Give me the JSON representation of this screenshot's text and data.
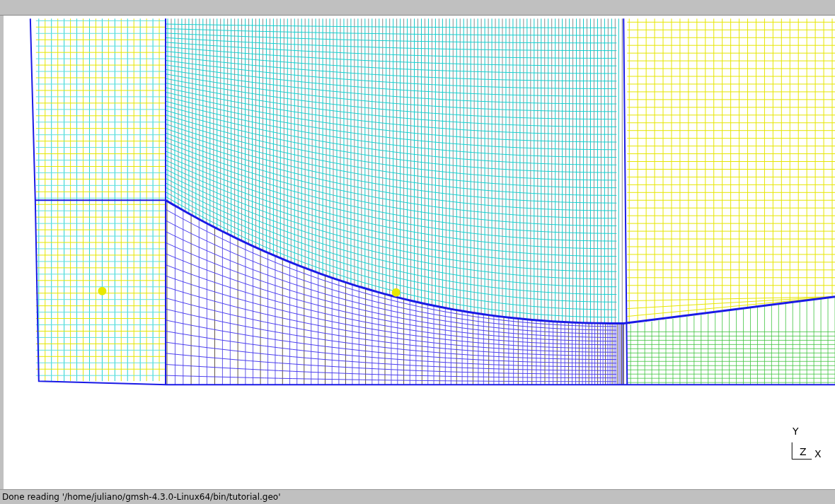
{
  "axes": [
    "Y",
    "Z",
    "X"
  ],
  "status_bar": "Done reading '/home/juliano/gmsh-4.3.0-Linux64/bin/tutorial.geo'"
}
